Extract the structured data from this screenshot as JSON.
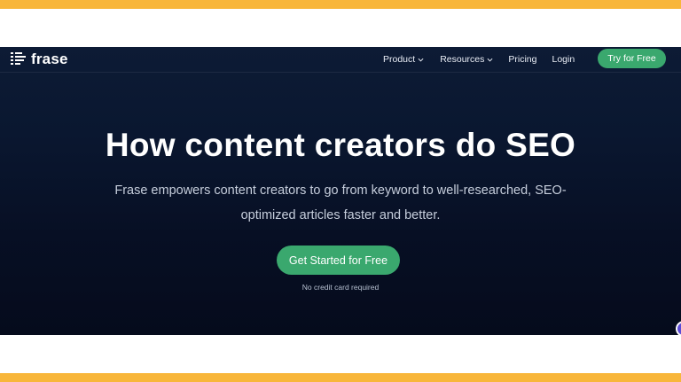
{
  "brand": {
    "name": "frase",
    "accent_color": "#3aa86e",
    "frame_color": "#f8b63a"
  },
  "nav": {
    "items": [
      {
        "label": "Product",
        "has_dropdown": true
      },
      {
        "label": "Resources",
        "has_dropdown": true
      },
      {
        "label": "Pricing",
        "has_dropdown": false
      },
      {
        "label": "Login",
        "has_dropdown": false
      }
    ],
    "cta_label": "Try for Free"
  },
  "hero": {
    "title": "How content creators do SEO",
    "subtitle": "Frase empowers content creators to go from keyword to well-researched, SEO-optimized articles faster and better.",
    "cta_label": "Get Started for Free",
    "cta_note": "No credit card required"
  },
  "icons": {
    "logo": "frase-logo-icon",
    "dropdown": "chevron-down-icon",
    "chat": "chat-bubble-icon"
  }
}
